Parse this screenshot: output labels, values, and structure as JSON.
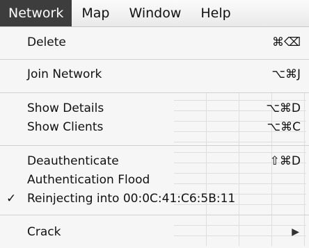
{
  "menubar": {
    "items": [
      "Network",
      "Map",
      "Window",
      "Help"
    ],
    "active": "Network"
  },
  "menu": {
    "delete": {
      "label": "Delete",
      "shortcut": "⌘⌫"
    },
    "join_network": {
      "label": "Join Network",
      "shortcut": "⌥⌘J"
    },
    "show_details": {
      "label": "Show Details",
      "shortcut": "⌥⌘D"
    },
    "show_clients": {
      "label": "Show Clients",
      "shortcut": "⌥⌘C"
    },
    "deauthenticate": {
      "label": "Deauthenticate",
      "shortcut": "⇧⌘D"
    },
    "authentication_flood": {
      "label": "Authentication Flood"
    },
    "reinjecting": {
      "label": "Reinjecting into 00:0C:41:C6:5B:11",
      "check": "✓"
    },
    "crack": {
      "label": "Crack",
      "arrow": "▶"
    }
  },
  "colors": {
    "active_menu_bg": "#3d3d3d",
    "menu_bg": "#f6f6f6"
  }
}
